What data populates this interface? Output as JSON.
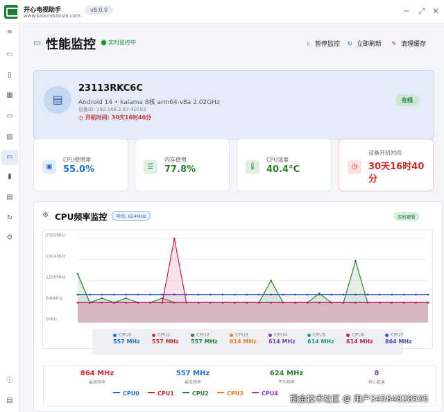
{
  "app": {
    "name": "开心电视助手",
    "url": "www.kaixindianshi.com",
    "version": "v8.0.0"
  },
  "window_controls": {
    "minimize": "─",
    "restore": "⤢",
    "close": "✕"
  },
  "sidebar": [
    {
      "icon": "menu-icon",
      "glyph": "≡"
    },
    {
      "icon": "monitor-icon",
      "glyph": "▭"
    },
    {
      "icon": "phone-icon",
      "glyph": "▯"
    },
    {
      "icon": "apps-icon",
      "glyph": "▦"
    },
    {
      "icon": "tv-icon",
      "glyph": "▭"
    },
    {
      "icon": "image-icon",
      "glyph": "▨"
    },
    {
      "icon": "laptop-icon",
      "glyph": "▭",
      "active": true
    },
    {
      "icon": "battery-icon",
      "glyph": "▮"
    },
    {
      "icon": "calendar-icon",
      "glyph": "▤"
    },
    {
      "icon": "refresh-icon",
      "glyph": "↻"
    },
    {
      "icon": "settings-icon",
      "glyph": "⚙"
    },
    {
      "icon": "info-icon",
      "glyph": "ⓘ"
    },
    {
      "icon": "document-icon",
      "glyph": "▤"
    }
  ],
  "page": {
    "title": "性能监控",
    "status": "实时监控中"
  },
  "actions": {
    "pause": "暂停监控",
    "refresh": "立即刷新",
    "clear_cache": "清理缓存"
  },
  "device": {
    "name": "23113RKC6C",
    "spec": "Android 14 • kalama 8核 arm64-v8a 2.02GHz",
    "id": "设备ID: 192.168.2.67:40793",
    "uptime": "开机时间: 30天16时40分",
    "status": "在线"
  },
  "stats": {
    "cpu": {
      "label": "CPU使用率",
      "value": "55.0%"
    },
    "memory": {
      "label": "内存使用",
      "value": "77.8%"
    },
    "temp": {
      "label": "CPU温度",
      "value": "40.4°C"
    },
    "boot": {
      "label": "设备开机时间",
      "value_line1": "30天16时40",
      "value_line2": "分"
    }
  },
  "chart_panel": {
    "title": "CPU频率监控",
    "average_badge": "平均: 624MHz",
    "realtime_badge": "实时更新"
  },
  "chart_data": {
    "type": "line",
    "y_tick_labels": [
      "2592MHz",
      "1944MHz",
      "1296MHz",
      "648MHz",
      "0MHz"
    ],
    "ylim": [
      0,
      2592
    ],
    "x": [
      0,
      1,
      2,
      3,
      4,
      5,
      6,
      7,
      8,
      9,
      10,
      11,
      12,
      13,
      14,
      15,
      16,
      17,
      18,
      19,
      20,
      21,
      22,
      23,
      24,
      25,
      26,
      27,
      28,
      29
    ],
    "series": [
      {
        "name": "CPU7",
        "color": "#3b4dbd",
        "values": [
          864,
          864,
          864,
          864,
          864,
          864,
          864,
          864,
          864,
          864,
          864,
          864,
          864,
          864,
          864,
          864,
          864,
          864,
          864,
          864,
          864,
          864,
          864,
          864,
          864,
          864,
          864,
          864,
          864,
          864
        ]
      },
      {
        "name": "CPU4",
        "color": "#2e7d32",
        "values": [
          1500,
          614,
          750,
          614,
          750,
          614,
          614,
          750,
          614,
          614,
          614,
          614,
          614,
          614,
          614,
          614,
          1296,
          614,
          614,
          614,
          900,
          614,
          614,
          1900,
          614,
          614,
          614,
          614,
          614,
          614
        ]
      },
      {
        "name": "CPU6",
        "color": "#c2185b",
        "values": [
          614,
          614,
          614,
          614,
          614,
          614,
          614,
          614,
          2592,
          614,
          614,
          614,
          614,
          614,
          614,
          614,
          614,
          614,
          614,
          614,
          614,
          614,
          614,
          614,
          614,
          614,
          614,
          614,
          614,
          614
        ]
      },
      {
        "name": "CPU0",
        "color": "#c2185b",
        "values": [
          614,
          614,
          614,
          614,
          614,
          614,
          614,
          614,
          614,
          614,
          614,
          614,
          614,
          614,
          614,
          614,
          614,
          614,
          614,
          614,
          614,
          614,
          614,
          614,
          614,
          614,
          614,
          614,
          614,
          614
        ]
      }
    ]
  },
  "cpu_legend": [
    {
      "name": "CPU0",
      "freq": "557 MHz",
      "color": "#1a6fd1"
    },
    {
      "name": "CPU1",
      "freq": "557 MHz",
      "color": "#d02b2b"
    },
    {
      "name": "CPU2",
      "freq": "557 MHz",
      "color": "#2e7d32"
    },
    {
      "name": "CPU3",
      "freq": "614 MHz",
      "color": "#ef7d1a"
    },
    {
      "name": "CPU4",
      "freq": "614 MHz",
      "color": "#7b3fb0"
    },
    {
      "name": "CPU5",
      "freq": "614 MHz",
      "color": "#1a9e8a"
    },
    {
      "name": "CPU6",
      "freq": "614 MHz",
      "color": "#c2185b"
    },
    {
      "name": "CPU7",
      "freq": "864 MHz",
      "color": "#3b4dbd"
    }
  ],
  "summary": {
    "max": {
      "value": "864 MHz",
      "label": "最高频率"
    },
    "min": {
      "value": "557 MHz",
      "label": "最低频率"
    },
    "avg": {
      "value": "624 MHz",
      "label": "平均频率"
    },
    "cores": {
      "value": "8",
      "label": "核心数量"
    }
  },
  "bottom_legend": [
    "CPU0",
    "CPU1",
    "CPU2",
    "CPU3",
    "CPU4"
  ],
  "watermark": "掘金技术社区 @ 用户34584828505"
}
